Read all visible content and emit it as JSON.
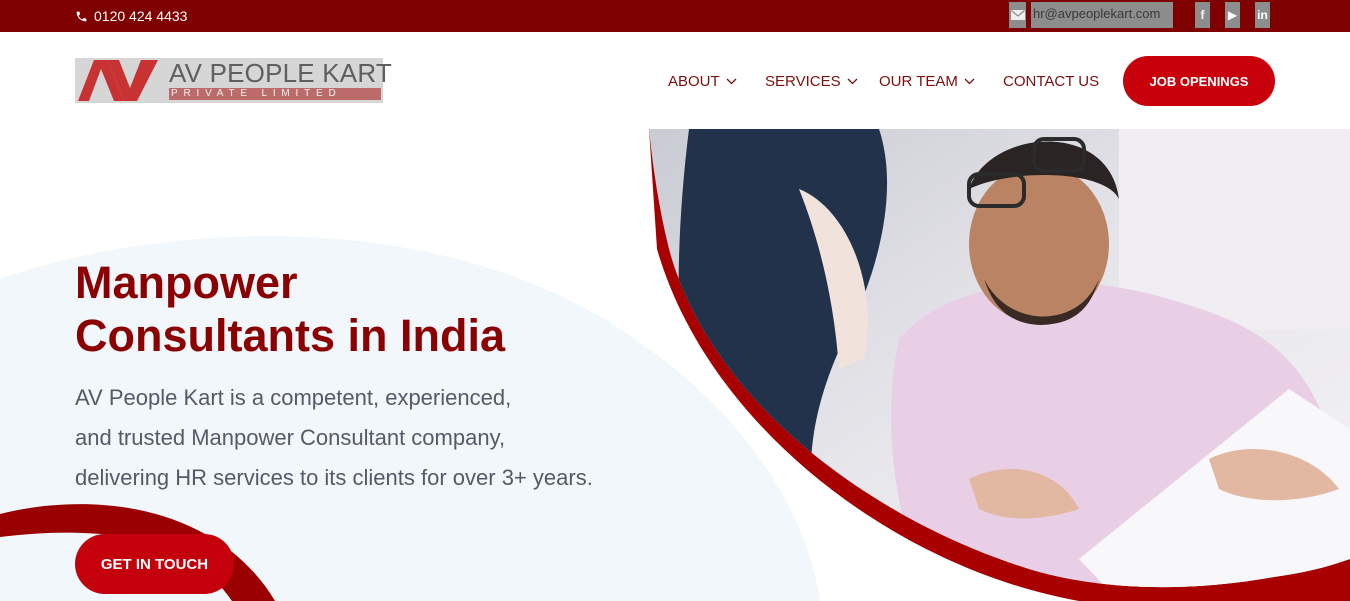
{
  "topbar": {
    "phone": "0120 424 4433",
    "email": "hr@avpeoplekart.com",
    "social": [
      {
        "name": "facebook",
        "glyph": "f"
      },
      {
        "name": "youtube",
        "glyph": "▶"
      },
      {
        "name": "linkedin",
        "glyph": "in"
      }
    ]
  },
  "logo": {
    "mark": "AV",
    "name": "AV PEOPLE KART",
    "sub": "PRIVATE LIMITED"
  },
  "nav": {
    "about": "ABOUT",
    "services": "SERVICES",
    "team": "OUR TEAM",
    "contact": "CONTACT US",
    "jobs": "JOB OPENINGS"
  },
  "hero": {
    "title_line1": "Manpower",
    "title_line2": "Consultants in India",
    "desc_line1": "AV People Kart is a competent, experienced,",
    "desc_line2": "and trusted Manpower Consultant company,",
    "desc_line3": "delivering HR services to its clients for over 3+ years.",
    "cta": "GET IN TOUCH"
  },
  "colors": {
    "brand_dark": "#7e0000",
    "brand_red": "#c8000c",
    "title": "#8b0000",
    "text": "#555b64"
  }
}
